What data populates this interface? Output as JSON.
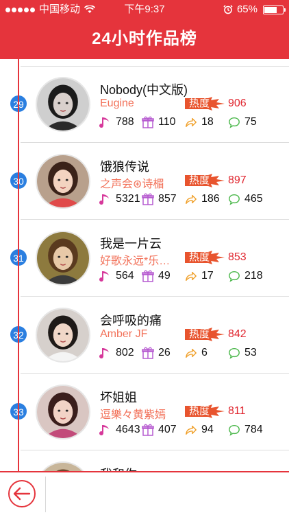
{
  "colors": {
    "brand": "#e5343c",
    "accent": "#2b7fe0",
    "artist": "#f27159",
    "heat": "#e0262f"
  },
  "status_bar": {
    "carrier": "中国移动",
    "time": "下午9:37",
    "battery": "65%",
    "battery_level": 0.65,
    "icons": [
      "signal-dots-icon",
      "wifi-icon",
      "alarm-icon",
      "battery-icon"
    ]
  },
  "header": {
    "title": "24小时作品榜"
  },
  "list": {
    "heat_label": "热度",
    "items": [
      {
        "rank": "29",
        "title": "Nobody(中文版)",
        "artist": "Eugine",
        "heat": "906",
        "plays": "788",
        "gifts": "110",
        "shares": "18",
        "comments": "75"
      },
      {
        "rank": "30",
        "title": "饿狼传说",
        "artist": "之声会⊛诗楣",
        "heat": "897",
        "plays": "5321",
        "gifts": "857",
        "shares": "186",
        "comments": "465"
      },
      {
        "rank": "31",
        "title": "我是一片云",
        "artist": "好歌永远*乐…",
        "heat": "853",
        "plays": "564",
        "gifts": "49",
        "shares": "17",
        "comments": "218"
      },
      {
        "rank": "32",
        "title": "会呼吸的痛",
        "artist": "Amber JF",
        "heat": "842",
        "plays": "802",
        "gifts": "26",
        "shares": "6",
        "comments": "53"
      },
      {
        "rank": "33",
        "title": "坏姐姐",
        "artist": "逗樂々黄紫嫣",
        "heat": "811",
        "plays": "4643",
        "gifts": "407",
        "shares": "94",
        "comments": "784"
      },
      {
        "rank": "",
        "title": "我和你",
        "artist": "",
        "heat": "",
        "plays": "",
        "gifts": "",
        "shares": "",
        "comments": ""
      }
    ]
  },
  "footer": {
    "back_icon": "back-arrow-icon"
  }
}
